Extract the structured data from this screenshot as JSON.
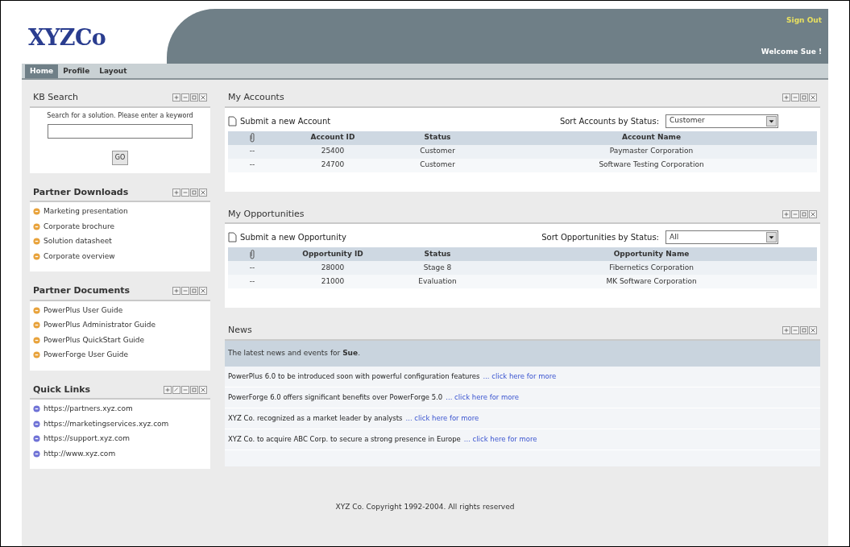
{
  "header": {
    "logo": "XYZCo",
    "sign_out": "Sign Out",
    "welcome": "Welcome Sue !"
  },
  "tabs": [
    {
      "label": "Home",
      "selected": true
    },
    {
      "label": "Profile",
      "selected": false
    },
    {
      "label": "Layout",
      "selected": false
    }
  ],
  "kb_search": {
    "title": "KB Search",
    "controls": [
      {
        "kind": "add"
      },
      {
        "kind": "minimize"
      },
      {
        "kind": "restore"
      },
      {
        "kind": "close"
      }
    ],
    "prompt": "Search for a solution. Please enter a keyword",
    "button": "GO"
  },
  "partner_downloads": {
    "title": "Partner Downloads",
    "controls": [
      {
        "kind": "add"
      },
      {
        "kind": "minimize"
      },
      {
        "kind": "restore"
      },
      {
        "kind": "close"
      }
    ],
    "items": [
      "Marketing presentation",
      "Corporate brochure",
      "Solution datasheet",
      "Corporate overview"
    ]
  },
  "partner_documents": {
    "title": "Partner Documents",
    "controls": [
      {
        "kind": "add"
      },
      {
        "kind": "minimize"
      },
      {
        "kind": "restore"
      },
      {
        "kind": "close"
      }
    ],
    "items": [
      "PowerPlus User Guide",
      "PowerPlus Administrator Guide",
      "PowerPlus QuickStart Guide",
      "PowerForge User Guide"
    ]
  },
  "quick_links": {
    "title": "Quick Links",
    "controls": [
      {
        "kind": "add"
      },
      {
        "kind": "edit"
      },
      {
        "kind": "minimize"
      },
      {
        "kind": "restore"
      },
      {
        "kind": "close"
      }
    ],
    "items": [
      "https://partners.xyz.com",
      "https://marketingservices.xyz.com",
      "https://support.xyz.com",
      "http://www.xyz.com"
    ]
  },
  "accounts": {
    "title": "My Accounts",
    "controls": [
      {
        "kind": "add"
      },
      {
        "kind": "minimize"
      },
      {
        "kind": "restore"
      },
      {
        "kind": "close"
      }
    ],
    "submit": "Submit a new Account",
    "sort_label": "Sort Accounts by Status:",
    "sort_value": "Customer",
    "columns": [
      "Account ID",
      "Status",
      "Account Name"
    ],
    "rows": [
      {
        "mark": "--",
        "id": "25400",
        "status": "Customer",
        "name": "Paymaster Corporation"
      },
      {
        "mark": "--",
        "id": "24700",
        "status": "Customer",
        "name": "Software Testing Corporation"
      }
    ]
  },
  "opportunities": {
    "title": "My Opportunities",
    "controls": [
      {
        "kind": "add"
      },
      {
        "kind": "minimize"
      },
      {
        "kind": "restore"
      },
      {
        "kind": "close"
      }
    ],
    "submit": "Submit a new Opportunity",
    "sort_label": "Sort Opportunities by Status:",
    "sort_value": "All",
    "columns": [
      "Opportunity ID",
      "Status",
      "Opportunity Name"
    ],
    "rows": [
      {
        "mark": "--",
        "id": "28000",
        "status": "Stage 8",
        "name": "Fibernetics Corporation"
      },
      {
        "mark": "--",
        "id": "21000",
        "status": "Evaluation",
        "name": "MK Software Corporation"
      }
    ]
  },
  "news": {
    "title": "News",
    "controls": [
      {
        "kind": "add"
      },
      {
        "kind": "minimize"
      },
      {
        "kind": "restore"
      },
      {
        "kind": "close"
      }
    ],
    "intro": "The latest news and events for **Sue**.",
    "items": [
      {
        "text": "PowerPlus 6.0 to be introduced soon with powerful configuration features",
        "link": "... click here for more"
      },
      {
        "text": "PowerForge 6.0 offers significant benefits over PowerForge 5.0",
        "link": "... click here for more"
      },
      {
        "text": "XYZ Co. recognized as a market leader by analysts",
        "link": "... click here for more"
      },
      {
        "text": "XYZ Co. to acquire ABC Corp. to secure a strong presence in Europe",
        "link": "... click here for more"
      }
    ]
  },
  "footer": "XYZ Co. Copyright 1992-2004. All rights reserved"
}
